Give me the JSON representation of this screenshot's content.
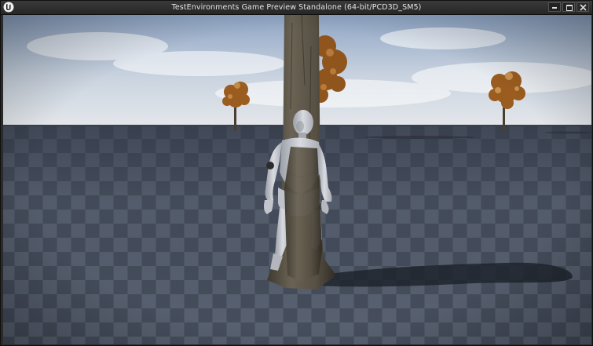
{
  "window": {
    "title": "TestEnvironments Game Preview Standalone (64-bit/PCD3D_SM5)",
    "app_icon": "unreal-engine-logo",
    "controls": [
      "minimize-icon",
      "maximize-icon",
      "close-icon"
    ]
  },
  "viewport": {
    "content": "3d-game-scene",
    "colors": {
      "sky_top": "#8fa6c6",
      "sky_bottom": "#e3e7ec",
      "floor_light": "#5b6474",
      "floor_dark": "#3f4654",
      "foliage": "#a7621f",
      "bark": "#5b5346",
      "mannequin": "#c9ccd2"
    }
  }
}
